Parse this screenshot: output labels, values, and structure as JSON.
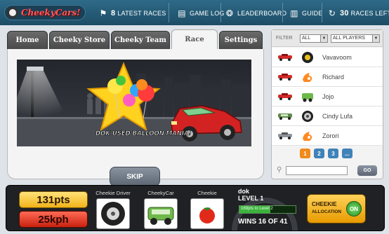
{
  "app": {
    "logo_text": "CheekyCars!"
  },
  "topbar": {
    "latest_races_count": "8",
    "latest_races_label": "LATEST RACES",
    "game_log_label": "GAME LOG",
    "leaderboard_label": "LEADERBOARD",
    "guide_label": "GUIDE",
    "races_left_count": "30",
    "races_left_label": "RACES LEFT"
  },
  "tabs": [
    {
      "label": "Home"
    },
    {
      "label": "Cheeky Store"
    },
    {
      "label": "Cheeky Team"
    },
    {
      "label": "Race",
      "active": true
    },
    {
      "label": "Settings"
    }
  ],
  "race": {
    "caption": "DOK USED BALLOON MANIA!",
    "skip_label": "SKIP"
  },
  "filter": {
    "label": "FILTER",
    "scope_value": "ALL",
    "players_value": "ALL PLAYERS"
  },
  "players": [
    {
      "name": "Vavavoom",
      "car_color": "#d42a2a",
      "driver": "tire-icon"
    },
    {
      "name": "Richard",
      "car_color": "#d42a2a",
      "driver": "fire-icon"
    },
    {
      "name": "Jojo",
      "car_color": "#d42a2a",
      "driver": "green-car-icon"
    },
    {
      "name": "Cindy Lufa",
      "car_color": "#5e8a4a",
      "driver": "wheel-icon"
    },
    {
      "name": "Zorori",
      "car_color": "#8e949a",
      "driver": "fire-icon"
    }
  ],
  "pagination": [
    "1",
    "2",
    "3",
    "..."
  ],
  "search": {
    "go_label": "GO",
    "placeholder": ""
  },
  "stats": {
    "points": "131pts",
    "speed": "25kph",
    "slot_driver_label": "Cheekie Driver",
    "slot_car_label": "CheekyCar",
    "slot_cheekie_label": "Cheekie",
    "player_name": "dok",
    "level_label": "LEVEL 1",
    "progress_text": "169pts to Level 2",
    "progress_fraction": 0.55,
    "wins_text": "WINS 16 OF 41",
    "alloc_line1": "CHEEKIE",
    "alloc_line2": "ALLOCATION",
    "alloc_state": "ON"
  },
  "colors": {
    "topbar": "#25597a",
    "pager_active": "#f08a1a",
    "pager_inactive": "#3f82b8",
    "points_gold": "#f2b31a",
    "speed_red": "#c8220f",
    "alloc_green": "#3bb33b"
  }
}
